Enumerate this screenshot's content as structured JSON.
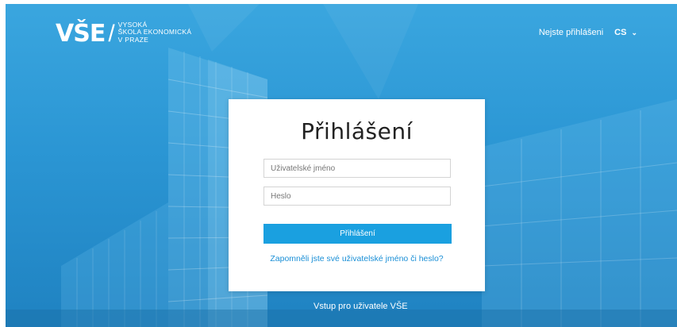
{
  "header": {
    "logo_mark": "VŠE",
    "logo_lines": [
      "VYSOKÁ",
      "ŠKOLA EKONOMICKÁ",
      "V PRAZE"
    ],
    "status_text": "Nejste přihlášeni",
    "language": "CS"
  },
  "login": {
    "title": "Přihlášení",
    "username_placeholder": "Uživatelské jméno",
    "password_placeholder": "Heslo",
    "submit_label": "Přihlášení",
    "forgot_link": "Zapomněli jste své uživatelské jméno či heslo?"
  },
  "footer": {
    "vse_users_link": "Vstup pro uživatele VŠE"
  },
  "colors": {
    "background": "#2b96d4",
    "button": "#1aa0e0",
    "link": "#1a8fd6"
  }
}
